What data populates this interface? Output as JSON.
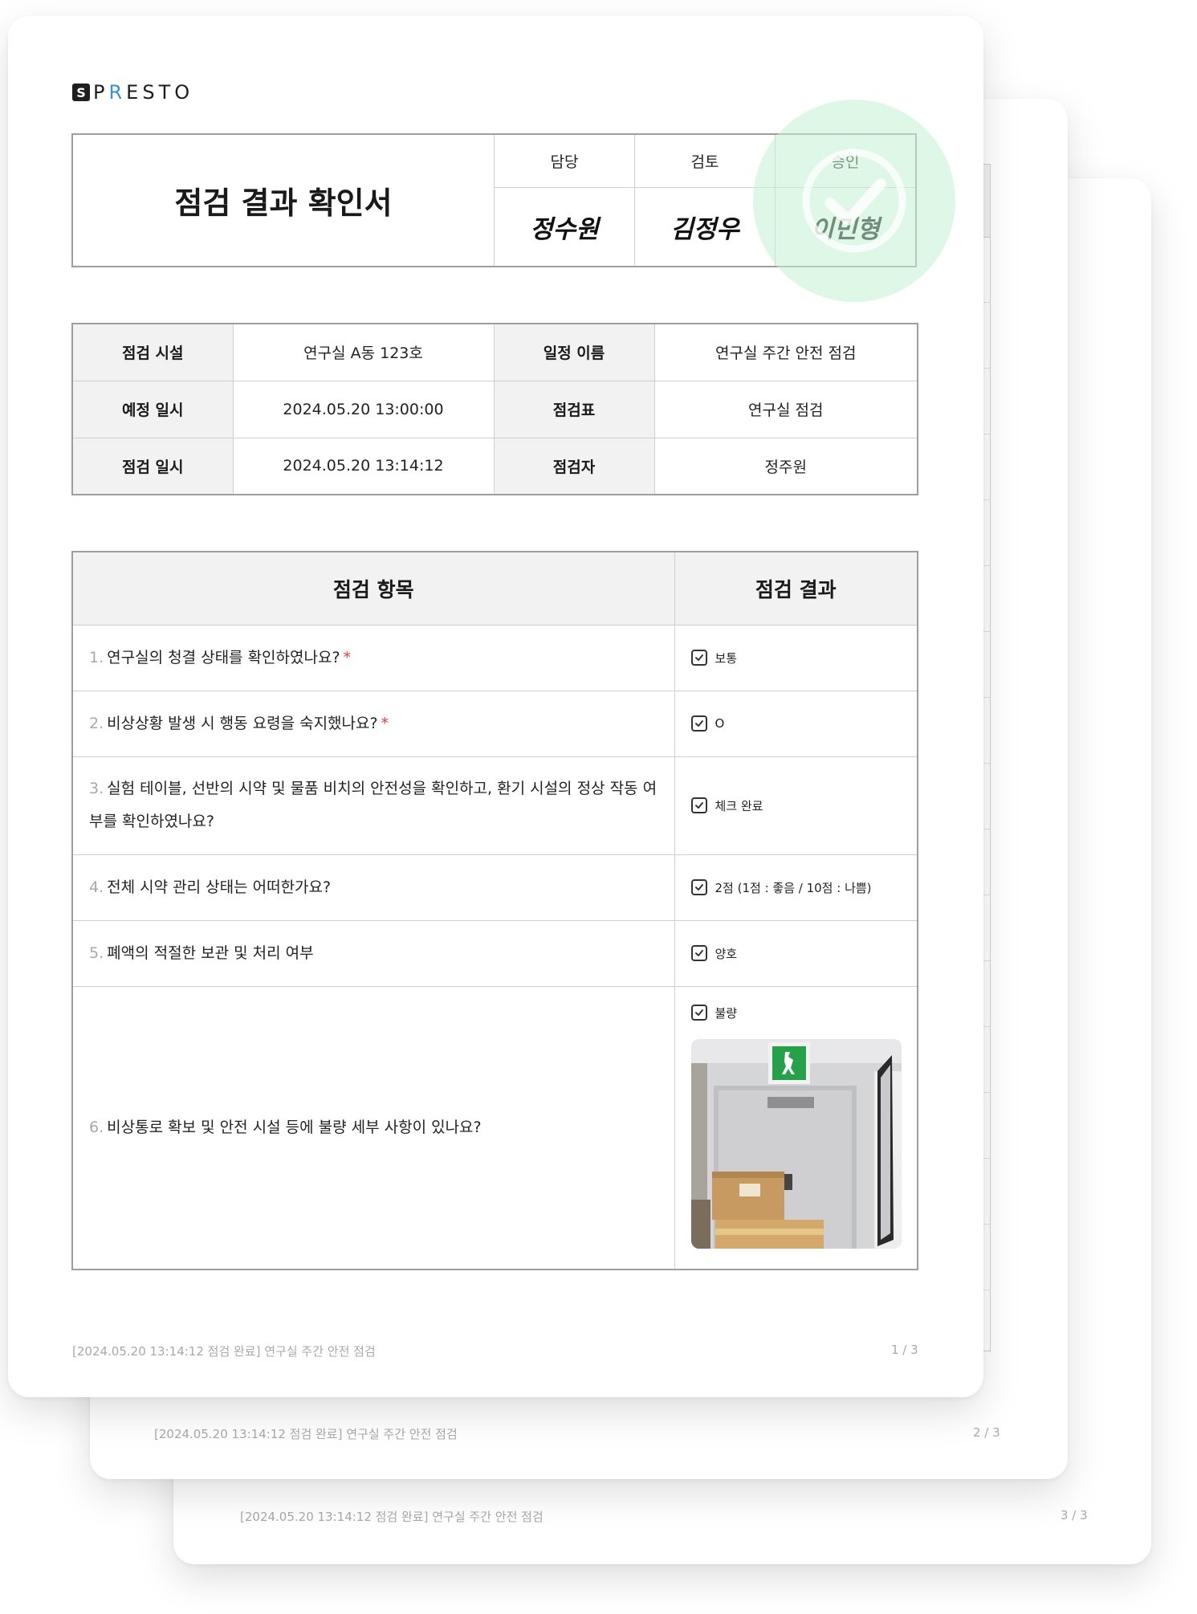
{
  "logo": {
    "mark": "S",
    "text_before": "P",
    "text_accent": "R",
    "text_after": "ESTO"
  },
  "document": {
    "title": "점검 결과 확인서",
    "approvals": [
      {
        "role": "담당",
        "name": "정수원"
      },
      {
        "role": "검토",
        "name": "김정우"
      },
      {
        "role": "승인",
        "name": "이민형"
      }
    ]
  },
  "info": {
    "facility_label": "점검 시설",
    "facility_value": "연구실 A동 123호",
    "schedule_name_label": "일정 이름",
    "schedule_name_value": "연구실 주간 안전 점검",
    "planned_label": "예정 일시",
    "planned_value": "2024.05.20 13:00:00",
    "checklist_label": "점검표",
    "checklist_value": "연구실 점검",
    "inspected_label": "점검 일시",
    "inspected_value": "2024.05.20 13:14:12",
    "inspector_label": "점검자",
    "inspector_value": "정주원"
  },
  "items": {
    "header_item": "점검 항목",
    "header_result": "점검 결과",
    "rows": [
      {
        "num": "1.",
        "question": "연구실의 청결 상태를 확인하였나요?",
        "required": "*",
        "answer": "보통"
      },
      {
        "num": "2.",
        "question": "비상상황 발생 시 행동 요령을 숙지했나요?",
        "required": "*",
        "answer": "O"
      },
      {
        "num": "3.",
        "question": "실험 테이블, 선반의 시약 및 물품 비치의 안전성을 확인하고, 환기 시설의 정상 작동 여부를 확인하였나요?",
        "required": "",
        "answer": "체크 완료"
      },
      {
        "num": "4.",
        "question": "전체 시약 관리 상태는 어떠한가요?",
        "required": "",
        "answer": "2점 (1점 : 좋음 / 10점 : 나쁨)"
      },
      {
        "num": "5.",
        "question": "폐액의 적절한 보관 및 처리 여부",
        "required": "",
        "answer": "양호"
      },
      {
        "num": "6.",
        "question": "비상통로 확보 및 안전 시설 등에 불량 세부 사항이 있나요?",
        "required": "",
        "answer": "불량"
      }
    ]
  },
  "footers": [
    {
      "text": "[2024.05.20 13:14:12 점검 완료] 연구실 주간 안전 점검",
      "page": "1 / 3"
    },
    {
      "text": "[2024.05.20 13:14:12 점검 완료] 연구실 주간 안전 점검",
      "page": "2 / 3"
    },
    {
      "text": "[2024.05.20 13:14:12 점검 완료] 연구실 주간 안전 점검",
      "page": "3 / 3"
    }
  ],
  "colors": {
    "accent_logo": "#3b8fd9",
    "stamp": "#c4f0d1",
    "required": "#e23b3b",
    "exit_sign": "#27a04a"
  }
}
